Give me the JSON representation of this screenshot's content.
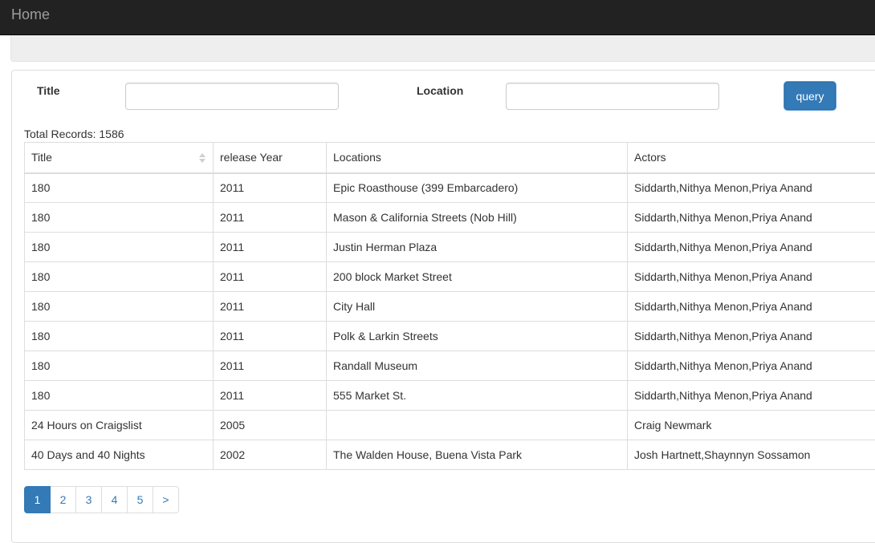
{
  "navbar": {
    "brand": "Home"
  },
  "form": {
    "title_label": "Title",
    "title_value": "",
    "location_label": "Location",
    "location_value": "",
    "query_label": "query"
  },
  "total_records": "Total Records: 1586",
  "table": {
    "columns": [
      "Title",
      "release Year",
      "Locations",
      "Actors"
    ],
    "rows": [
      [
        "180",
        "2011",
        "Epic Roasthouse (399 Embarcadero)",
        "Siddarth,Nithya Menon,Priya Anand"
      ],
      [
        "180",
        "2011",
        "Mason & California Streets (Nob Hill)",
        "Siddarth,Nithya Menon,Priya Anand"
      ],
      [
        "180",
        "2011",
        "Justin Herman Plaza",
        "Siddarth,Nithya Menon,Priya Anand"
      ],
      [
        "180",
        "2011",
        "200 block Market Street",
        "Siddarth,Nithya Menon,Priya Anand"
      ],
      [
        "180",
        "2011",
        "City Hall",
        "Siddarth,Nithya Menon,Priya Anand"
      ],
      [
        "180",
        "2011",
        "Polk & Larkin Streets",
        "Siddarth,Nithya Menon,Priya Anand"
      ],
      [
        "180",
        "2011",
        "Randall Museum",
        "Siddarth,Nithya Menon,Priya Anand"
      ],
      [
        "180",
        "2011",
        "555 Market St.",
        "Siddarth,Nithya Menon,Priya Anand"
      ],
      [
        "24 Hours on Craigslist",
        "2005",
        "",
        "Craig Newmark"
      ],
      [
        "40 Days and 40 Nights",
        "2002",
        "The Walden House, Buena Vista Park",
        "Josh Hartnett,Shaynnyn Sossamon"
      ]
    ]
  },
  "pagination": {
    "pages": [
      "1",
      "2",
      "3",
      "4",
      "5",
      ">"
    ],
    "active": "1"
  },
  "icons": {
    "sort": "sort-icon"
  },
  "colors": {
    "navbar": "#222222",
    "primary": "#337ab7",
    "border": "#dddddd"
  }
}
